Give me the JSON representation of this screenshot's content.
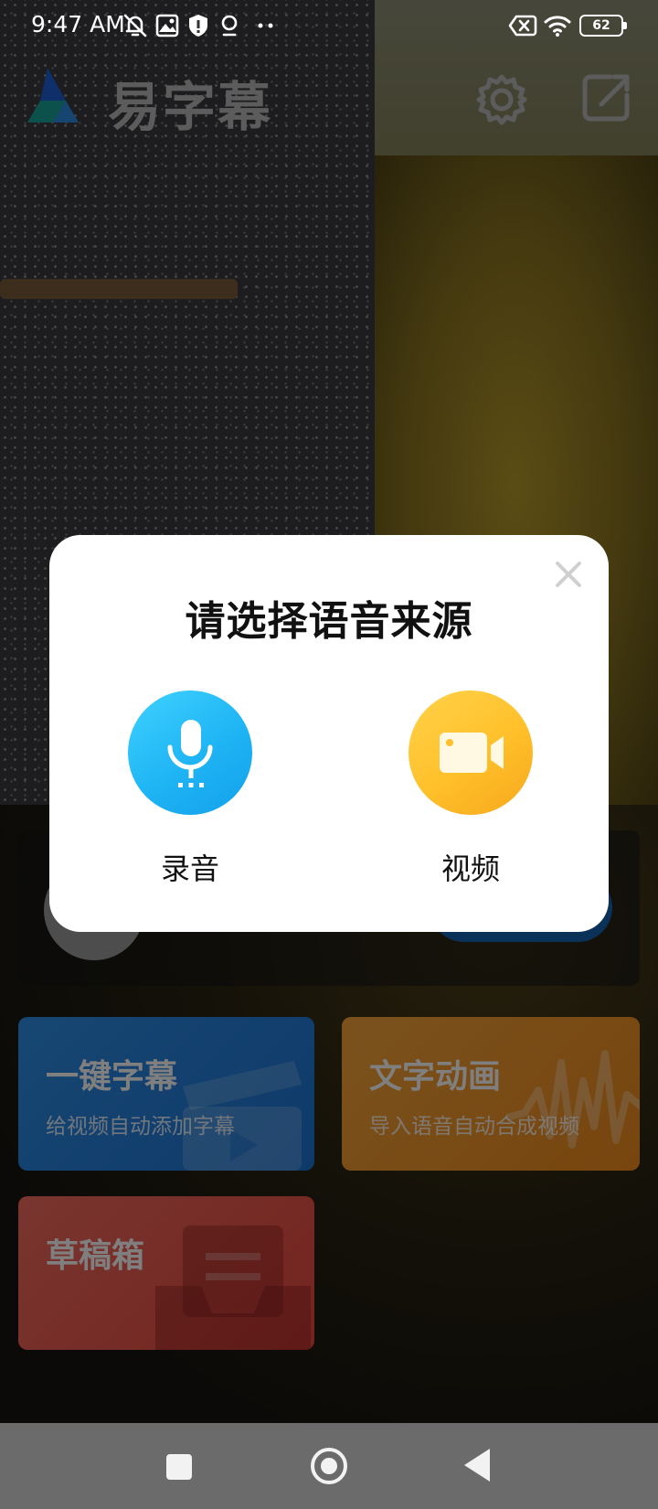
{
  "status_bar": {
    "time": "9:47 AM",
    "icons": [
      "notifications-off-icon",
      "photo-icon",
      "shield-icon",
      "location-pin-icon",
      "more-dots-icon",
      "sim-error-icon",
      "wifi-icon"
    ],
    "battery": "62"
  },
  "app": {
    "title": "易字幕",
    "header_icons": [
      "app-logo-icon",
      "settings-gear-icon",
      "share-export-icon"
    ]
  },
  "home": {
    "cards": [
      {
        "title": "一键字幕",
        "subtitle": "给视频自动添加字幕",
        "color": "#1d74d4"
      },
      {
        "title": "文字动画",
        "subtitle": "导入语音自动合成视频",
        "color": "#f08a1c"
      },
      {
        "title": "草稿箱",
        "subtitle": "",
        "color": "#e8483e"
      }
    ]
  },
  "dialog": {
    "title": "请选择语音来源",
    "close_icon": "close-icon",
    "options": [
      {
        "label": "录音",
        "icon": "microphone-icon",
        "color": "#1fb4f4"
      },
      {
        "label": "视频",
        "icon": "video-camera-icon",
        "color": "#ffc02a"
      }
    ]
  },
  "nav_bar": {
    "buttons": [
      "recent-apps",
      "home",
      "back"
    ]
  }
}
